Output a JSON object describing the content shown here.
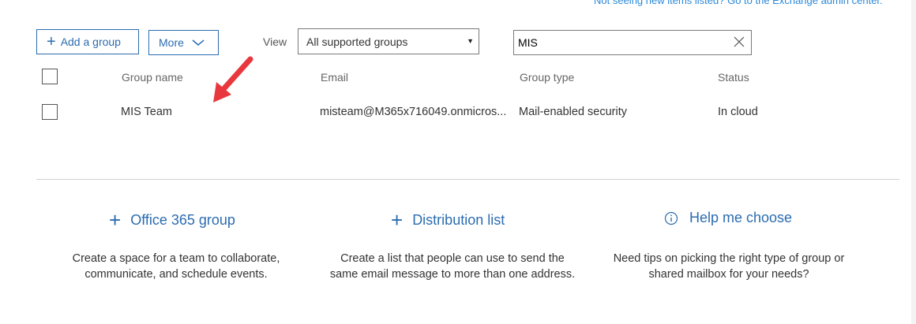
{
  "notice": "Not seeing new items listed? Go to the Exchange admin center.",
  "toolbar": {
    "add_group_label": "Add a group",
    "more_label": "More",
    "view_label": "View",
    "view_selected": "All supported groups",
    "search_value": "MIS"
  },
  "table": {
    "headers": [
      "Group name",
      "Email",
      "Group type",
      "Status"
    ],
    "rows": [
      {
        "name": "MIS Team",
        "email": "misteam@M365x716049.onmicros...",
        "type": "Mail-enabled security",
        "status": "In cloud"
      }
    ]
  },
  "actions": [
    {
      "label": "Office 365 group",
      "icon": "plus-icon",
      "description": "Create a space for a team to collaborate, communicate, and schedule events."
    },
    {
      "label": "Distribution list",
      "icon": "plus-icon",
      "description": "Create a list that people can use to send the same email message to more than one address."
    },
    {
      "label": "Help me choose",
      "icon": "info-icon",
      "description": "Need tips on picking the right type of group or shared mailbox for your needs?"
    }
  ],
  "colors": {
    "accent": "#2b6cb0",
    "link": "#2b88d8",
    "arrow": "#e8383d",
    "text": "#333333",
    "header_text": "#666666",
    "divider": "#d0d0d0"
  }
}
